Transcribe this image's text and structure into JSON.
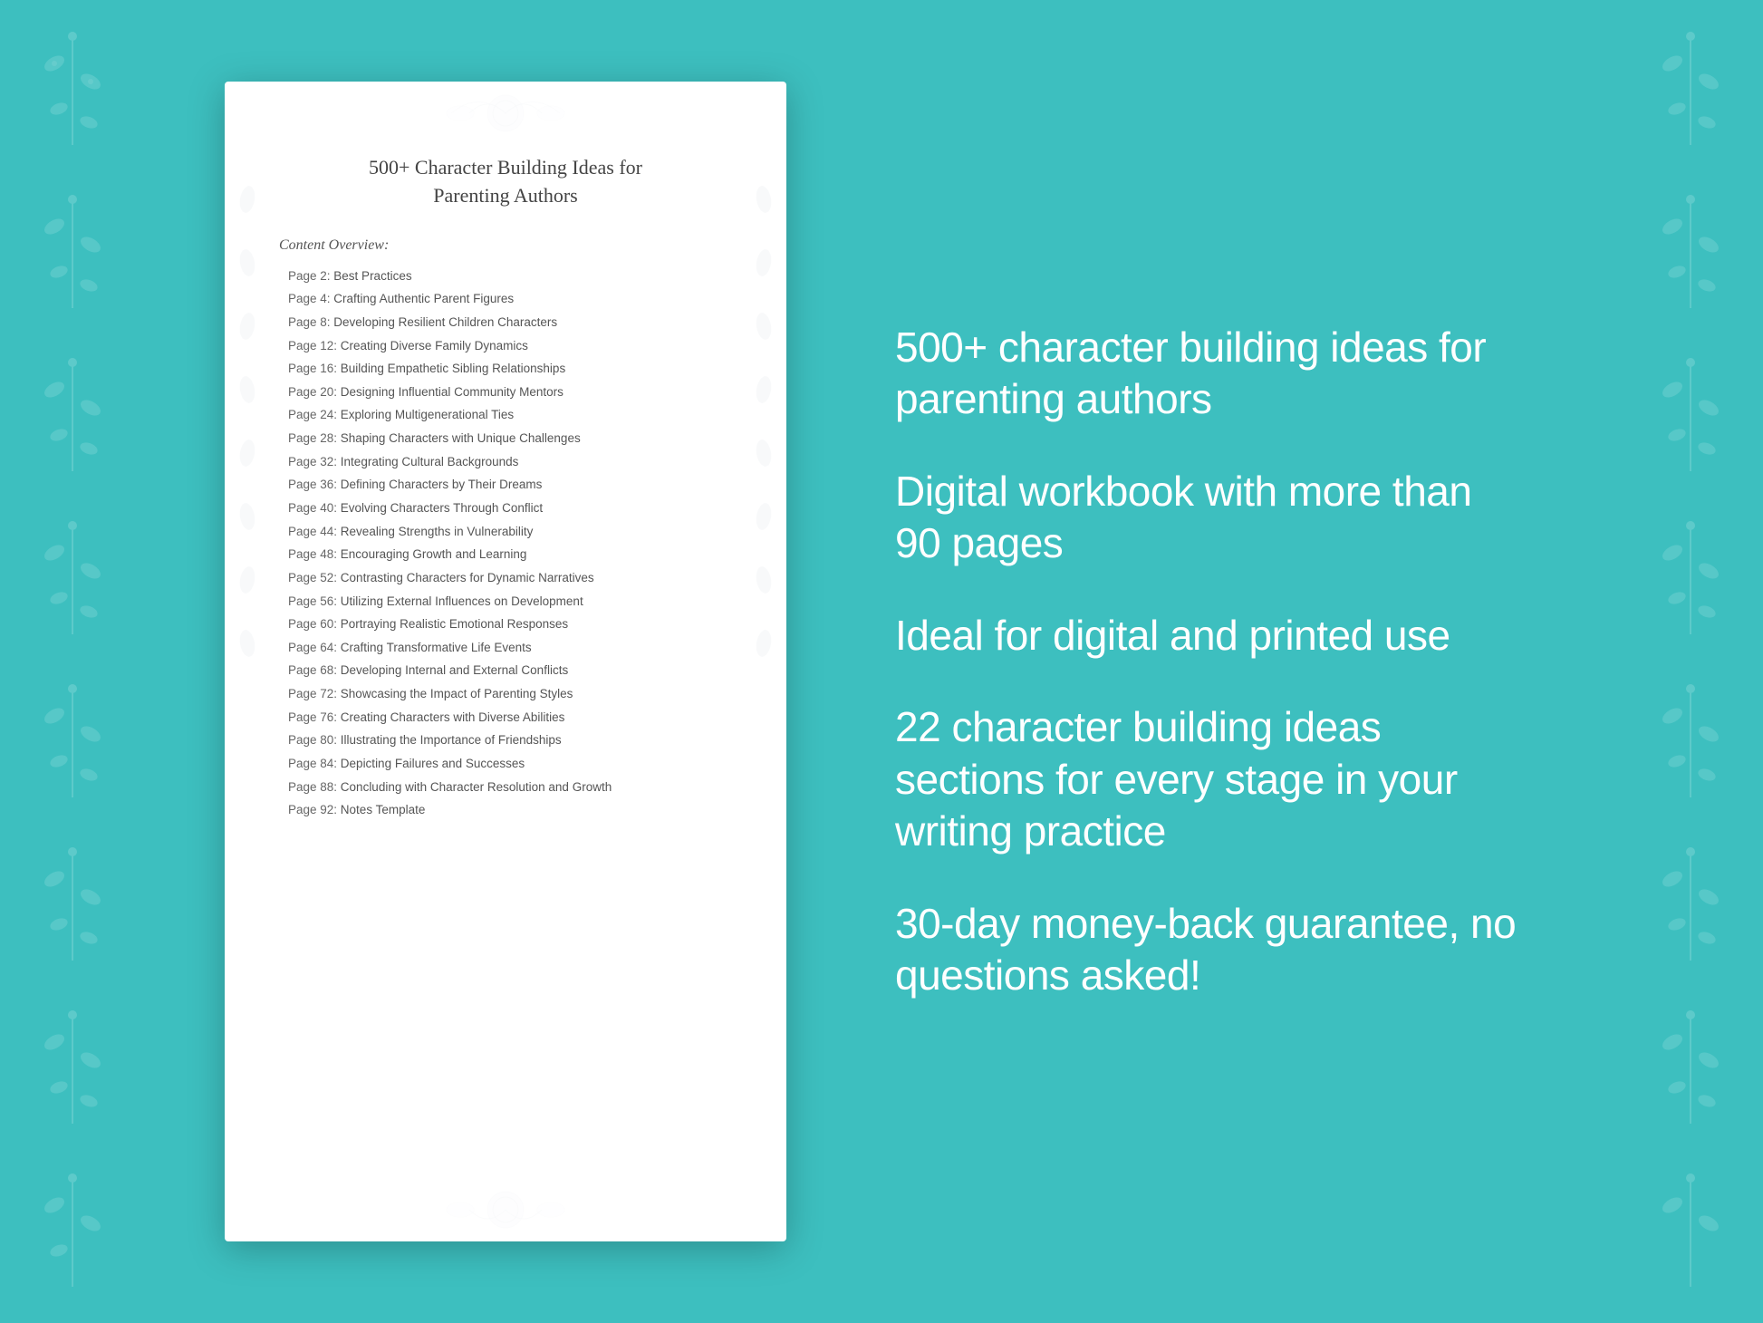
{
  "background": {
    "color": "#3dbfbf"
  },
  "document": {
    "title_line1": "500+ Character Building Ideas for",
    "title_line2": "Parenting Authors",
    "content_overview_label": "Content Overview:",
    "toc_items": [
      {
        "page": "Page  2:",
        "title": "Best Practices"
      },
      {
        "page": "Page  4:",
        "title": "Crafting Authentic Parent Figures"
      },
      {
        "page": "Page  8:",
        "title": "Developing Resilient Children Characters"
      },
      {
        "page": "Page 12:",
        "title": "Creating Diverse Family Dynamics"
      },
      {
        "page": "Page 16:",
        "title": "Building Empathetic Sibling Relationships"
      },
      {
        "page": "Page 20:",
        "title": "Designing Influential Community Mentors"
      },
      {
        "page": "Page 24:",
        "title": "Exploring Multigenerational Ties"
      },
      {
        "page": "Page 28:",
        "title": "Shaping Characters with Unique Challenges"
      },
      {
        "page": "Page 32:",
        "title": "Integrating Cultural Backgrounds"
      },
      {
        "page": "Page 36:",
        "title": "Defining Characters by Their Dreams"
      },
      {
        "page": "Page 40:",
        "title": "Evolving Characters Through Conflict"
      },
      {
        "page": "Page 44:",
        "title": "Revealing Strengths in Vulnerability"
      },
      {
        "page": "Page 48:",
        "title": "Encouraging Growth and Learning"
      },
      {
        "page": "Page 52:",
        "title": "Contrasting Characters for Dynamic Narratives"
      },
      {
        "page": "Page 56:",
        "title": "Utilizing External Influences on Development"
      },
      {
        "page": "Page 60:",
        "title": "Portraying Realistic Emotional Responses"
      },
      {
        "page": "Page 64:",
        "title": "Crafting Transformative Life Events"
      },
      {
        "page": "Page 68:",
        "title": "Developing Internal and External Conflicts"
      },
      {
        "page": "Page 72:",
        "title": "Showcasing the Impact of Parenting Styles"
      },
      {
        "page": "Page 76:",
        "title": "Creating Characters with Diverse Abilities"
      },
      {
        "page": "Page 80:",
        "title": "Illustrating the Importance of Friendships"
      },
      {
        "page": "Page 84:",
        "title": "Depicting Failures and Successes"
      },
      {
        "page": "Page 88:",
        "title": "Concluding with Character Resolution and Growth"
      },
      {
        "page": "Page 92:",
        "title": "Notes Template"
      }
    ]
  },
  "features": [
    {
      "id": "feature1",
      "text": "500+ character building ideas for parenting authors"
    },
    {
      "id": "feature2",
      "text": "Digital workbook with more than 90 pages"
    },
    {
      "id": "feature3",
      "text": "Ideal for digital and printed use"
    },
    {
      "id": "feature4",
      "text": "22 character building ideas sections for every stage in your writing practice"
    },
    {
      "id": "feature5",
      "text": "30-day money-back guarantee, no questions asked!"
    }
  ]
}
